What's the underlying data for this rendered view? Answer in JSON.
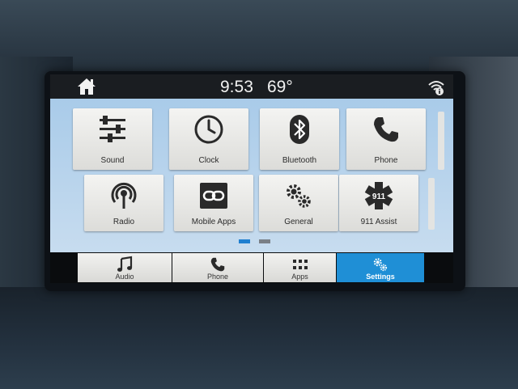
{
  "status": {
    "time": "9:53",
    "temperature": "69°",
    "home_icon": "home-icon",
    "wifi_icon": "wifi-icon"
  },
  "tiles": [
    {
      "label": "Sound",
      "icon": "sliders-icon"
    },
    {
      "label": "Clock",
      "icon": "clock-icon"
    },
    {
      "label": "Bluetooth",
      "icon": "bluetooth-icon"
    },
    {
      "label": "Phone",
      "icon": "phone-icon"
    },
    {
      "label": "Radio",
      "icon": "radio-icon"
    },
    {
      "label": "Mobile Apps",
      "icon": "mobile-apps-icon"
    },
    {
      "label": "General",
      "icon": "gears-icon"
    },
    {
      "label": "911 Assist",
      "icon": "911-assist-icon",
      "badge": "911"
    }
  ],
  "pager": {
    "page_count": 2,
    "current_page": 1
  },
  "tabs": [
    {
      "label": "Audio",
      "icon": "music-note-icon"
    },
    {
      "label": "Phone",
      "icon": "phone-icon"
    },
    {
      "label": "Apps",
      "icon": "apps-grid-icon"
    },
    {
      "label": "Settings",
      "icon": "gears-icon",
      "active": true
    }
  ],
  "colors": {
    "accent": "#1f8fd6",
    "tile_area": "#b7d3ec",
    "pager_active": "#1f7fd0",
    "pager_inactive": "#7a7f86"
  }
}
